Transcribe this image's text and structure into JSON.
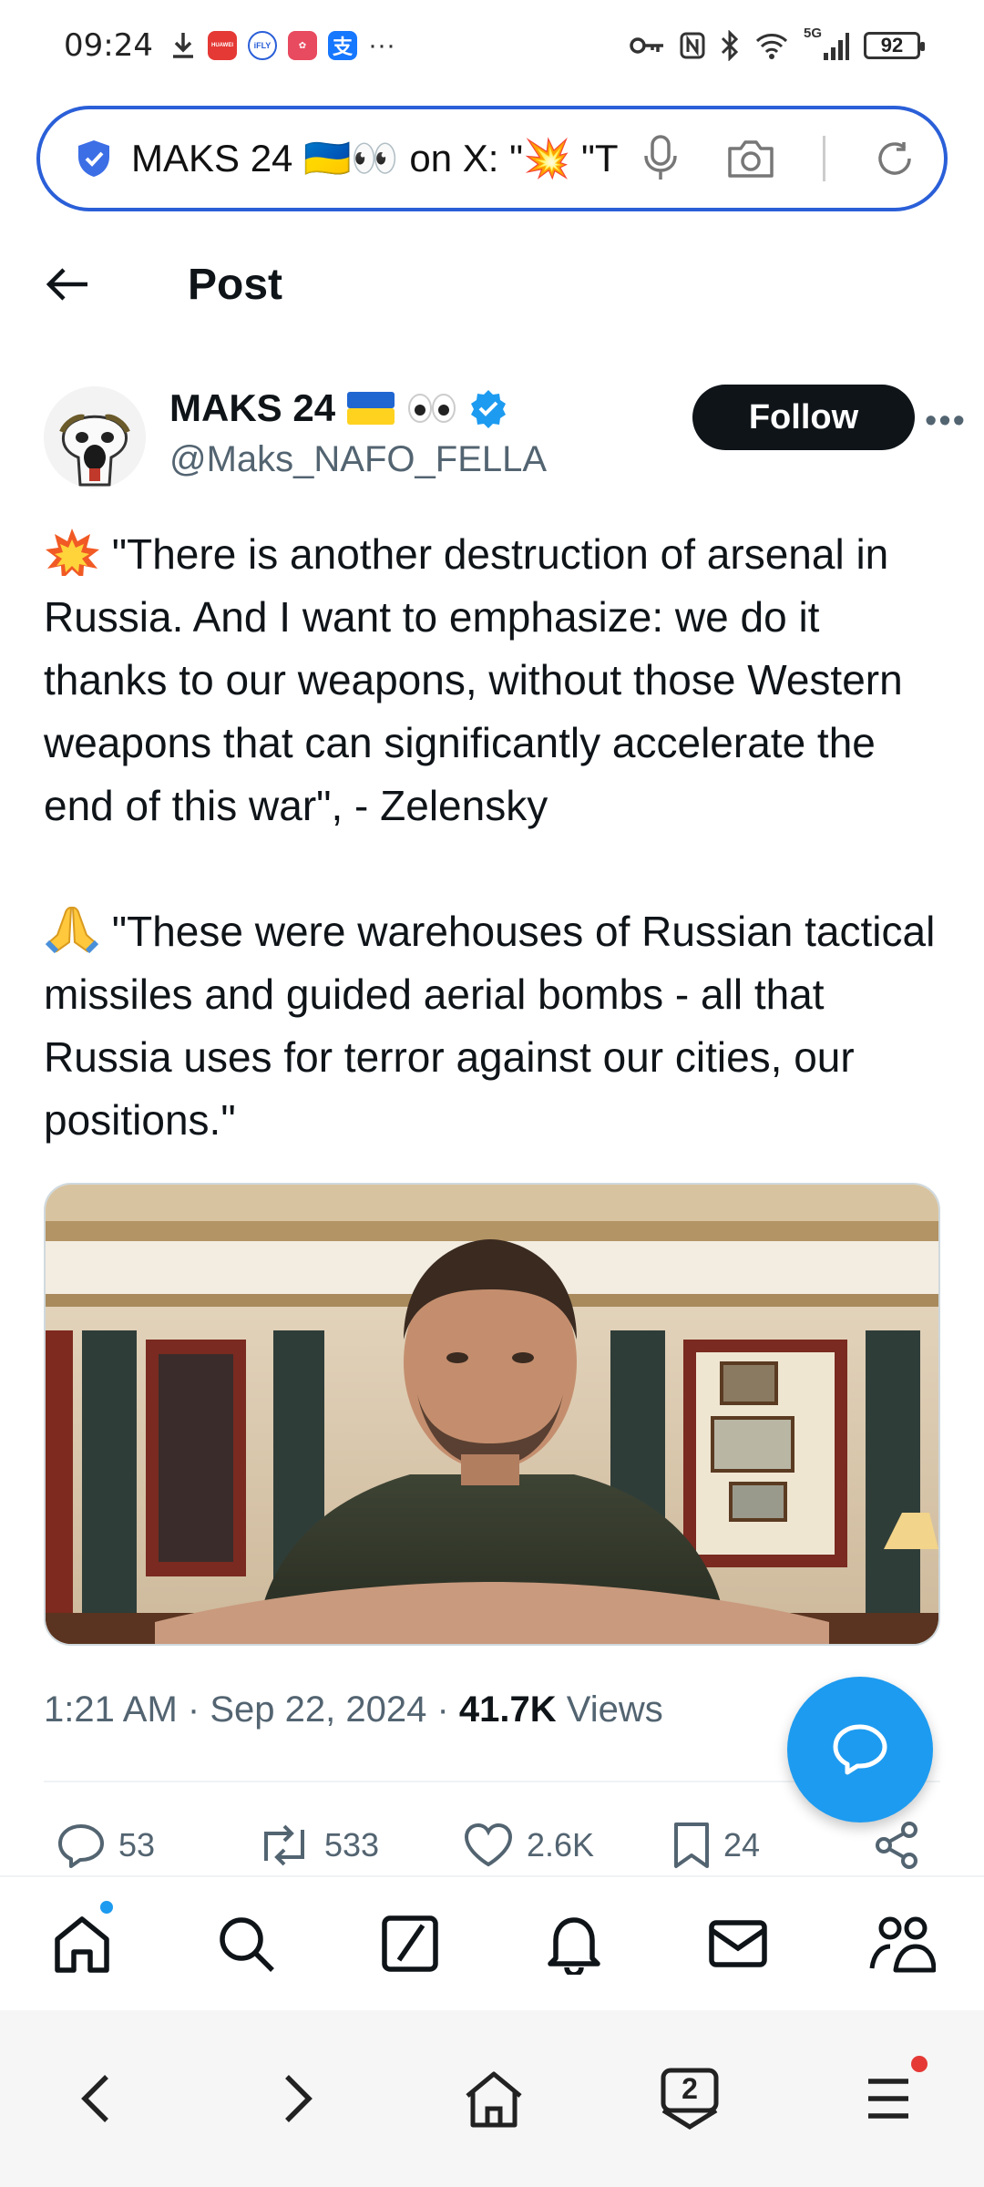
{
  "status_bar": {
    "time": "09:24",
    "app_icons": [
      "download-icon",
      "huawei-app-icon",
      "ifly-app-icon",
      "app-icon",
      "alipay-icon",
      "more-dots-icon"
    ],
    "mini_labels": [
      "HUAWEI",
      "iFLY",
      "",
      "支"
    ],
    "network": "5G",
    "battery": "92"
  },
  "browser": {
    "url_text": "MAKS 24 🇺🇦👀 on X: \"💥 \"T",
    "tabs_count": "2"
  },
  "header": {
    "title": "Post"
  },
  "author": {
    "name": "MAKS 24",
    "name_emoji": "🇺🇦👀",
    "handle": "@Maks_NAFO_FELLA",
    "follow_label": "Follow",
    "more_label": "•••",
    "verified": true
  },
  "tweet": {
    "paragraph1": "\"There is another destruction of arsenal in Russia. And I want to emphasize: we do it thanks to our weapons, without those Western weapons that can significantly accelerate the end of this war\", - Zelensky",
    "paragraph2": "\"These were warehouses of Russian tactical missiles and guided aerial bombs - all that Russia uses for terror against our cities, our positions.\""
  },
  "meta": {
    "time": "1:21 AM",
    "date": "Sep 22, 2024",
    "views_count": "41.7K",
    "views_label": "Views"
  },
  "actions": {
    "replies": "53",
    "reposts": "533",
    "likes": "2.6K",
    "bookmarks": "24"
  },
  "colors": {
    "accent": "#1d9bf0",
    "url_border": "#2a5fd8",
    "text": "#0f1419",
    "muted": "#536471"
  }
}
